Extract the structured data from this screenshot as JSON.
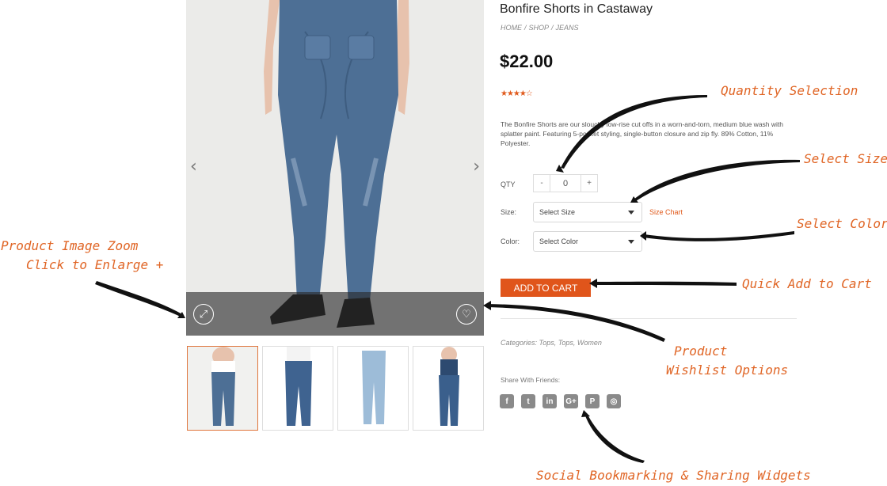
{
  "product": {
    "title": "Bonfire Shorts in Castaway",
    "breadcrumb": [
      "HOME",
      "/",
      "SHOP",
      "/",
      "JEANS"
    ],
    "price": "$22.00",
    "rating_text": "★★★★☆",
    "rating_value": 4,
    "description": "The Bonfire Shorts are our slouchy low-rise cut offs in a worn-and-torn, medium blue wash with splatter paint. Featuring 5-pocket styling, single-button closure and zip fly. 89% Cotton, 11% Polyester."
  },
  "form": {
    "qty_label": "QTY",
    "qty_minus": "-",
    "qty_value": "0",
    "qty_plus": "+",
    "size_label": "Size:",
    "size_placeholder": "Select Size",
    "size_chart": "Size Chart",
    "color_label": "Color:",
    "color_placeholder": "Select Color",
    "add_to_cart": "ADD TO CART"
  },
  "meta": {
    "categories": "Categories: Tops, Tops, Women",
    "share_label": "Share With Friends:",
    "social_icons": [
      "facebook-icon",
      "twitter-icon",
      "linkedin-icon",
      "google-plus-icon",
      "pinterest-icon",
      "instagram-icon"
    ],
    "social_glyphs": [
      "f",
      "t",
      "in",
      "G+",
      "P",
      "◎"
    ]
  },
  "gallery": {
    "prev_glyph": "‹",
    "next_glyph": "›",
    "zoom_glyph": "⤢",
    "wishlist_glyph": "♡"
  },
  "callouts": {
    "quantity": "Quantity Selection",
    "size": "Select Size",
    "color": "Select Color",
    "cart": "Quick Add to Cart",
    "wishlist_line1": "Product",
    "wishlist_line2": "Wishlist Options",
    "zoom_line1": "Product Image Zoom",
    "zoom_line2": "Click to Enlarge +",
    "social": "Social Bookmarking & Sharing Widgets"
  },
  "colors": {
    "accent": "#e0551b",
    "callout": "#e06525",
    "jeans": "#4d6f95"
  }
}
